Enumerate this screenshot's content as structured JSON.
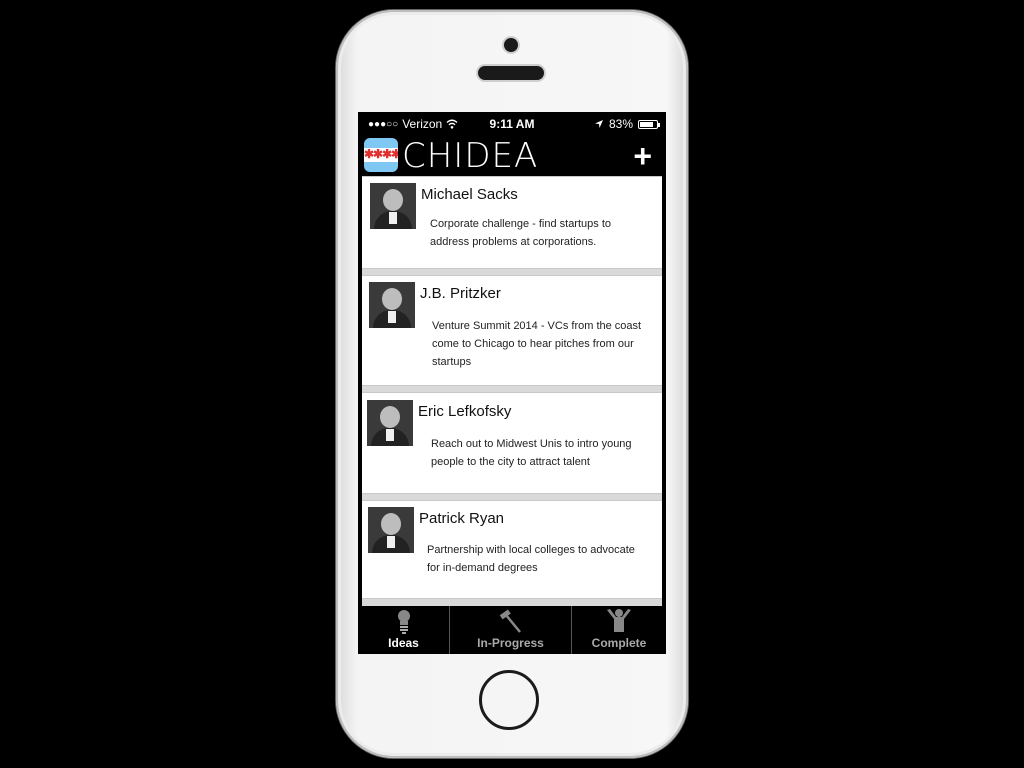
{
  "status_bar": {
    "signal": "●●●○○",
    "carrier": "Verizon",
    "wifi": "wifi-icon",
    "time": "9:11 AM",
    "location": "location-arrow-icon",
    "battery_text": "83%",
    "battery_level": 0.83
  },
  "header": {
    "title": "CHIDEA",
    "logo": "chicago-flag-logo",
    "add_label": "+"
  },
  "ideas": [
    {
      "name": "Michael Sacks",
      "text": "Corporate challenge - find startups to address problems at corporations."
    },
    {
      "name": "J.B. Pritzker",
      "text": "Venture Summit 2014 - VCs from the coast come to Chicago to hear pitches from our startups"
    },
    {
      "name": "Eric Lefkofsky",
      "text": "Reach out to Midwest Unis to intro young people to the city to attract talent"
    },
    {
      "name": "Patrick Ryan",
      "text": "Partnership with local colleges to advocate for in-demand degrees"
    }
  ],
  "tabs": [
    {
      "label": "Ideas",
      "icon": "lightbulb-icon",
      "active": true
    },
    {
      "label": "In-Progress",
      "icon": "hammer-icon",
      "active": false
    },
    {
      "label": "Complete",
      "icon": "raised-arms-person-icon",
      "active": false
    }
  ]
}
